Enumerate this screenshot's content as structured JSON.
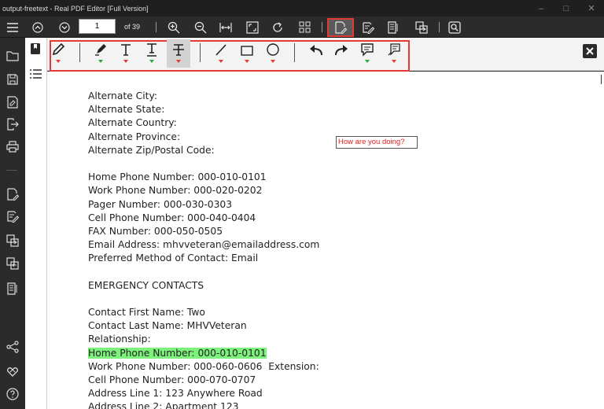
{
  "window": {
    "title": "output-freetext - Real PDF Editor [Full Version]",
    "controls": [
      "–",
      "□",
      "✕"
    ]
  },
  "toolbar": {
    "page_number": "1",
    "page_count_label": "of 39"
  },
  "sticky_note": "How are you doing?",
  "document": {
    "lines": [
      "Alternate City:",
      "Alternate State:",
      "Alternate Country:",
      "Alternate Province:",
      "Alternate Zip/Postal Code:",
      "",
      "Home Phone Number: 000-010-0101",
      "Work Phone Number: 000-020-0202",
      "Pager Number: 000-030-0303",
      "Cell Phone Number: 000-040-0404",
      "FAX Number: 000-050-0505",
      "Email Address: mhvveteran@emailaddress.com",
      "Preferred Method of Contact: Email",
      "",
      "EMERGENCY CONTACTS",
      "",
      "Contact First Name: Two",
      "Contact Last Name: MHVVeteran",
      "Relationship:",
      "Home Phone Number: 000-010-0101",
      "Work Phone Number: 000-060-0606  Extension:",
      "Cell Phone Number: 000-070-0707",
      "Address Line 1: 123 Anywhere Road",
      "Address Line 2: Apartment 123"
    ],
    "highlighted_line_index": 19
  },
  "colors": {
    "highlight": "#7cf27c",
    "annotation_red": "#e53935",
    "annotation_green": "#2ea83a",
    "sticky_text": "#e02020"
  },
  "annotation_tools": [
    "pencil-icon",
    "marker-icon",
    "text-icon",
    "underline-text-icon",
    "strikeout-text-icon",
    "line-icon",
    "rectangle-icon",
    "ellipse-icon",
    "undo-icon",
    "redo-icon",
    "comment-icon",
    "note-icon"
  ]
}
